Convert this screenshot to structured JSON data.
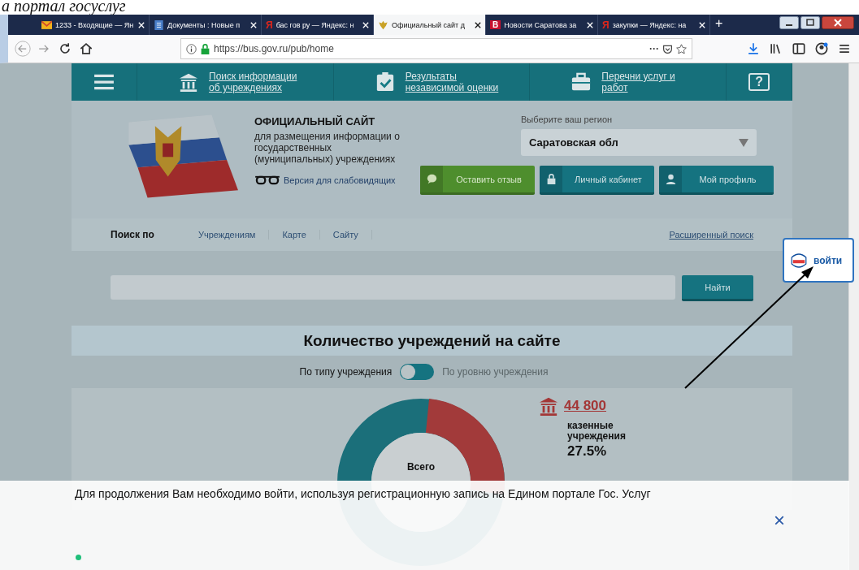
{
  "caption": "а портал госуслуг",
  "browser": {
    "tabs": [
      {
        "label": "1233 - Входящие — Ян",
        "selected": false,
        "kind": "mail"
      },
      {
        "label": "Документы : Новые п",
        "selected": false,
        "kind": "doc"
      },
      {
        "label": "бас гов ру — Яндекс: н",
        "selected": false,
        "kind": "letter",
        "icon_text": "Я"
      },
      {
        "label": "Официальный сайт д",
        "selected": true,
        "kind": "crest"
      },
      {
        "label": "Новости Саратова за",
        "selected": false,
        "kind": "badge",
        "icon_text": "B"
      },
      {
        "label": "закупки — Яндекс: на",
        "selected": false,
        "kind": "letter",
        "icon_text": "Я"
      }
    ],
    "new_tab": "+",
    "url": "https://bus.gov.ru/pub/home",
    "page_actions": "···"
  },
  "site": {
    "nav": [
      {
        "kind": "menu"
      },
      {
        "kind": "building",
        "label": "Поиск информации об учреждениях"
      },
      {
        "kind": "check",
        "label": "Результаты независимой оценки"
      },
      {
        "kind": "case",
        "label": "Перечни услуг и работ"
      },
      {
        "kind": "help",
        "label": "?"
      }
    ],
    "title": "ОФИЦИАЛЬНЫЙ САЙТ",
    "subtitle": "для размещения информации о государственных (муниципальных) учреждениях",
    "low_vision_link": "Версия для слабовидящих",
    "region_label": "Выберите ваш регион",
    "region_value": "Саратовская обл",
    "buttons": [
      {
        "kind": "feedback",
        "label": "Оставить отзыв"
      },
      {
        "kind": "lock",
        "label": "Личный кабинет"
      },
      {
        "kind": "person",
        "label": "Мой профиль"
      }
    ],
    "search_prefix": "Поиск по",
    "search_tabs": [
      {
        "label": "Учреждениям",
        "selected": false
      },
      {
        "label": "Карте",
        "selected": false
      },
      {
        "label": "Сайту",
        "selected": false
      }
    ],
    "advanced_search": "Расширенный поиск",
    "search_button": "Найти",
    "stats_title": "Количество учреждений на сайте",
    "toggle": {
      "on": false,
      "options": [
        {
          "label": "По типу учреждения",
          "selected": true
        },
        {
          "label": "По уровню учреждения",
          "selected": false
        }
      ]
    },
    "total_label": "Всего",
    "stat": {
      "value": "44 800",
      "label": "казенные учреждения",
      "percent": "27.5%"
    }
  },
  "login": {
    "label": "войти"
  },
  "banner": {
    "message": "Для продолжения Вам необходимо войти, используя регистрационную запись на Едином портале Гос. Услуг",
    "close": "×"
  }
}
